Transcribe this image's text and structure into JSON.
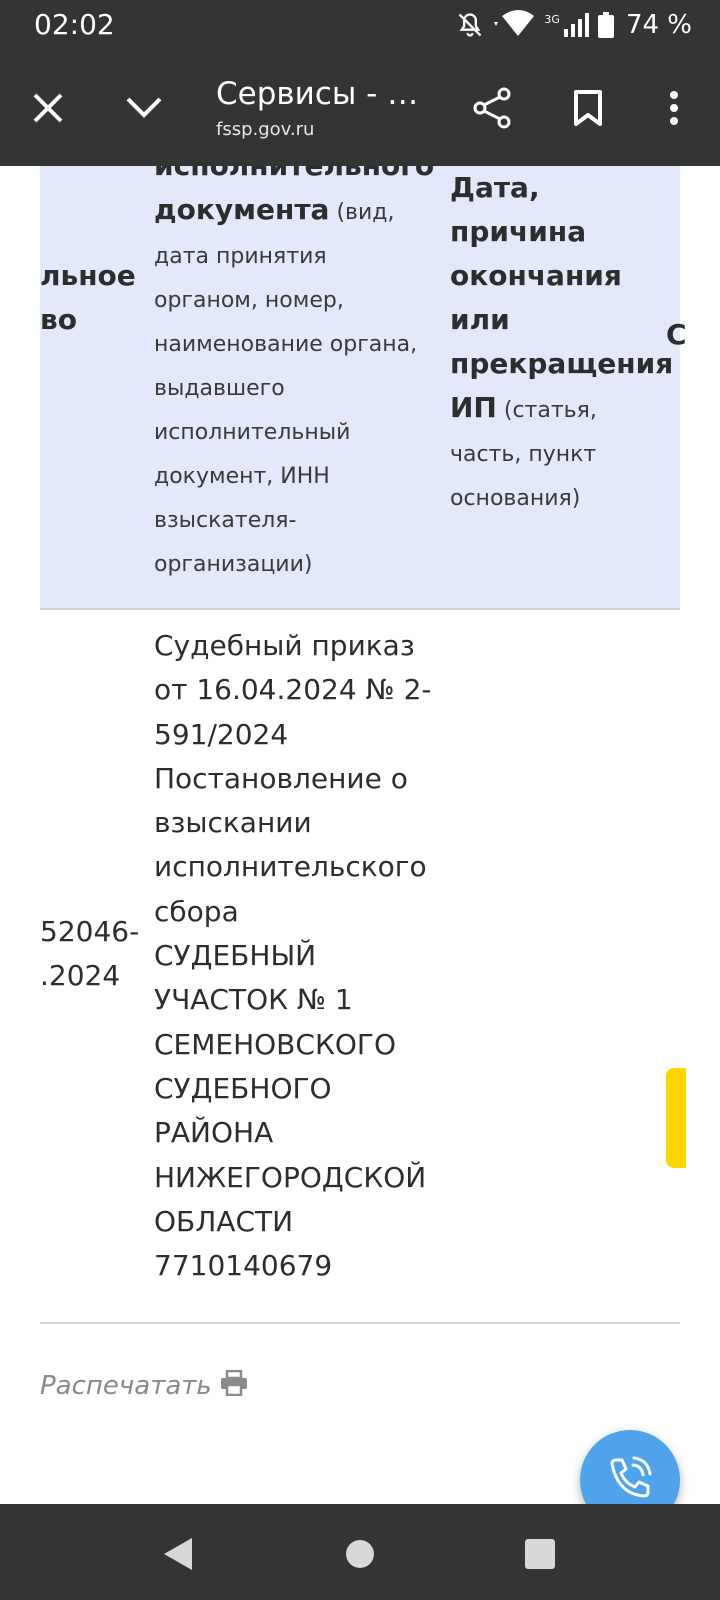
{
  "status_bar": {
    "time": "02:02",
    "network_type": "3G",
    "battery_percent": "74 %",
    "icons": [
      "bell-off-icon",
      "wifi-icon",
      "signal-icon",
      "battery-icon"
    ]
  },
  "toolbar": {
    "title": "Сервисы - …",
    "url": "fssp.gov.ru",
    "icons": [
      "close-icon",
      "chevron-down-icon",
      "share-icon",
      "bookmark-icon",
      "more-vert-icon"
    ]
  },
  "table": {
    "header": {
      "col1_lines": [
        "льное",
        "во"
      ],
      "col2_lines": [
        {
          "text": "исполнительного",
          "style": "bold"
        },
        {
          "text": "документа",
          "style": "bold",
          "suffix": " (вид,"
        },
        {
          "text": "дата принятия",
          "style": "small"
        },
        {
          "text": "органом, номер,",
          "style": "small"
        },
        {
          "text": "наименование органа,",
          "style": "small"
        },
        {
          "text": "выдавшего",
          "style": "small"
        },
        {
          "text": "исполнительный",
          "style": "small"
        },
        {
          "text": "документ, ИНН",
          "style": "small"
        },
        {
          "text": "взыскателя-",
          "style": "small"
        },
        {
          "text": "организации)",
          "style": "small"
        }
      ],
      "col3_lines": [
        {
          "text": "Дата,",
          "style": "bold"
        },
        {
          "text": "причина",
          "style": "bold"
        },
        {
          "text": "окончания",
          "style": "bold"
        },
        {
          "text": "или",
          "style": "bold"
        },
        {
          "text": "прекращения",
          "style": "bold"
        },
        {
          "text": "ИП",
          "style": "bold",
          "suffix": " (статья,"
        },
        {
          "text": "часть, пункт",
          "style": "small"
        },
        {
          "text": "основания)",
          "style": "small"
        }
      ],
      "col4_partial": "С"
    },
    "row": {
      "col1_lines": [
        "52046-",
        ".2024"
      ],
      "col2_lines": [
        "Судебный приказ",
        "от 16.04.2024 № 2-",
        "591/2024",
        "Постановление о",
        "взыскании",
        "исполнительского",
        "сбора",
        "СУДЕБНЫЙ",
        "УЧАСТОК № 1",
        "СЕМЕНОВСКОГО",
        "СУДЕБНОГО",
        "РАЙОНА",
        "НИЖЕГОРОДСКОЙ",
        "ОБЛАСТИ",
        "7710140679"
      ]
    }
  },
  "print_label": "Распечатать",
  "colors": {
    "bar_bg": "#333436",
    "header_bg": "#e3e9fb",
    "fab": "#4ea3ea",
    "tag": "#ffd400"
  }
}
